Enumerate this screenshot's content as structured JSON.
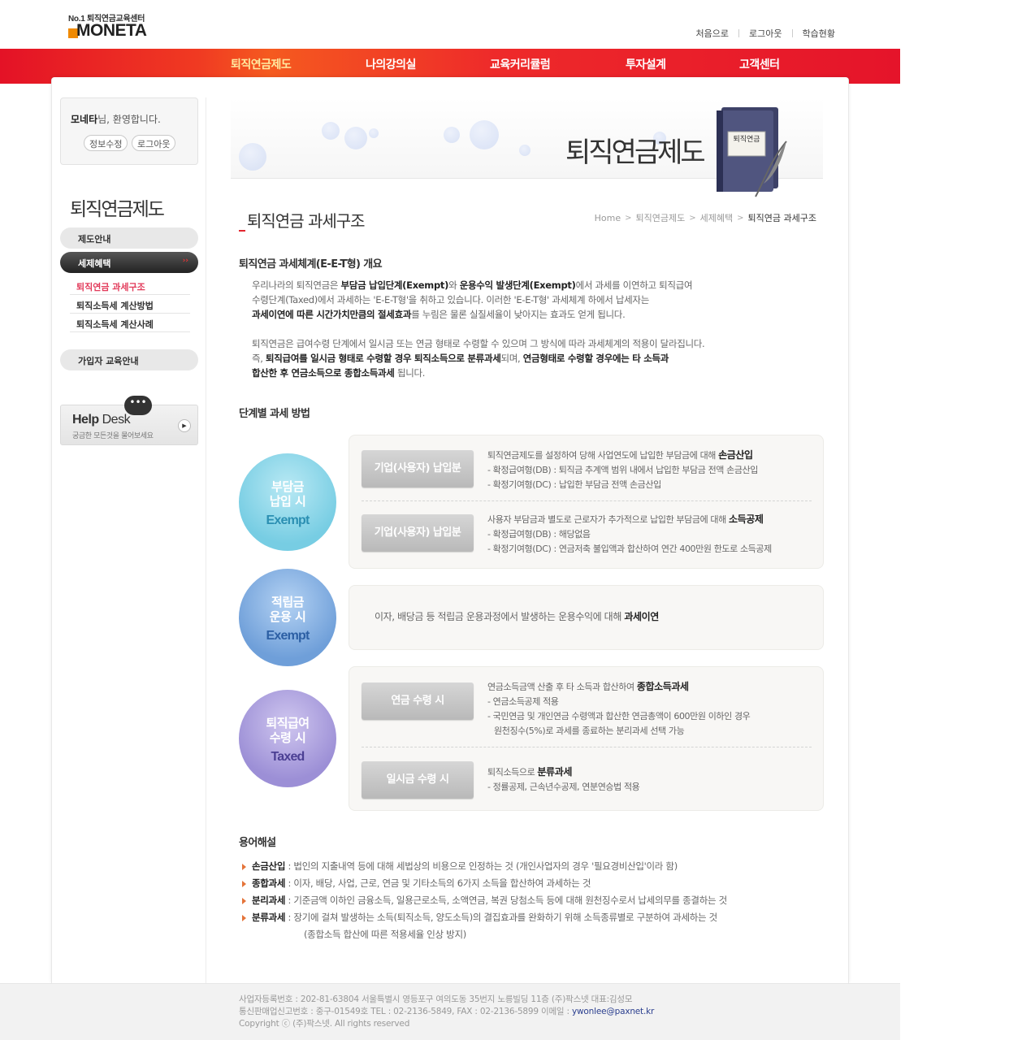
{
  "header": {
    "logo_top": "No.1 퇴직연금교육센터",
    "logo_word": "MONETA",
    "util_links": [
      "처음으로",
      "로그아웃",
      "학습현황"
    ]
  },
  "gnb": {
    "items": [
      "퇴직연금제도",
      "나의강의실",
      "교육커리큘럼",
      "투자설계",
      "고객센터"
    ],
    "active": "퇴직연금제도"
  },
  "login": {
    "user": "모네타",
    "greeting": "님, 환영합니다.",
    "edit_info": "정보수정",
    "logout": "로그아웃"
  },
  "lnb": {
    "title": "퇴직연금제도",
    "menu1": "제도안내",
    "menu2": "세제혜택",
    "sub": [
      "퇴직연금 과세구조",
      "퇴직소득세 계산방법",
      "퇴직소득세 계산사례"
    ],
    "menu3": "가입자 교육안내",
    "arrow": "››"
  },
  "help": {
    "title_bold": "Help",
    "title_rest": " Desk",
    "sub": "궁금한 모든것을 물어보세요",
    "bubble": "•••"
  },
  "visual": {
    "title": "퇴직연금제도",
    "book_label": "퇴직연금"
  },
  "page": {
    "title": "퇴직연금 과세구조",
    "breadcrumb": [
      "Home",
      "퇴직연금제도",
      "세제혜택",
      "퇴직연금 과세구조"
    ]
  },
  "section1": {
    "title": "퇴직연금 과세체계(E-E-T형) 개요",
    "p1_l1_a": "우리나라의 퇴직연금은 ",
    "p1_l1_b": "부담금 납입단계(Exempt)",
    "p1_l1_c": "와 ",
    "p1_l1_d": "운용수익 발생단계(Exempt)",
    "p1_l1_e": "에서 과세를 이연하고 퇴직급여",
    "p1_l2": "수령단계(Taxed)에서 과세하는 'E-E-T형'을 취하고 있습니다. 이러한 'E-E-T형' 과세체계 하에서 납세자는",
    "p1_l3_b": "과세이연에 따른 시간가치만큼의 절세효과",
    "p1_l3_c": "를 누림은 물론 실질세율이 낮아지는 효과도 얻게 됩니다.",
    "p2_l1": "퇴직연금은 급여수령 단계에서 일시금 또는 연금 형태로 수령할 수 있으며 그 방식에 따라 과세체계의 적용이 달라집니다.",
    "p2_l2_a": "즉, ",
    "p2_l2_b": "퇴직급여를 일시금 형태로 수령할 경우 퇴직소득으로 분류과세",
    "p2_l2_c": "되며, ",
    "p2_l2_d": "연금형태로 수령할 경우에는 타 소득과",
    "p2_l3_b": "합산한 후 연금소득으로 종합소득과세",
    "p2_l3_c": " 됩니다."
  },
  "section2": {
    "title": "단계별 과세 방법",
    "stage1": {
      "circle_l1": "부담금",
      "circle_l2": "납입 시",
      "circle_en": "Exempt",
      "row1": {
        "button": "기업(사용자) 납입분",
        "line1_a": "퇴직연금제도를 설정하여 당해 사업연도에 납입한 부담금에 대해 ",
        "line1_b": "손금산입",
        "line2": "- 확정급여형(DB) : 퇴직금 추계액 범위 내에서 납입한 부담금 전액 손금산입",
        "line3": "- 확정기여형(DC) : 납입한 부담금 전액 손금산입"
      },
      "row2": {
        "button": "기업(사용자) 납입분",
        "line1_a": "사용자 부담금과 별도로 근로자가 추가적으로 납입한 부담금에 대해 ",
        "line1_b": "소득공제",
        "line2": "- 확정급여형(DB) : 해당없음",
        "line3": "- 확정기여형(DC) : 연금저축 불입액과 합산하여 연간 400만원 한도로 소득공제"
      }
    },
    "stage2": {
      "circle_l1": "적립금",
      "circle_l2": "운용 시",
      "circle_en": "Exempt",
      "text_a": "이자, 배당금 등 적립금 운용과정에서 발생하는 운용수익에 대해 ",
      "text_b": "과세이연"
    },
    "stage3": {
      "circle_l1": "퇴직급여",
      "circle_l2": "수령 시",
      "circle_en": "Taxed",
      "row1": {
        "button": "연금 수령 시",
        "line1_a": "연금소득금액 산출 후 타 소득과 합산하여 ",
        "line1_b": "종합소득과세",
        "line2": "- 연금소득공제 적용",
        "line3": "- 국민연금 및 개인연금 수령액과 합산한 연금총액이 600만원 이하인 경우",
        "line4": "  원천징수(5%)로 과세를 종료하는 분리과세 선택 가능"
      },
      "row2": {
        "button": "일시금 수령 시",
        "line1_a": "퇴직소득으로 ",
        "line1_b": "분류과세",
        "line2": "- 정률공제, 근속년수공제, 연분연승법 적용"
      }
    }
  },
  "section3": {
    "title": "용어해설",
    "terms": [
      {
        "term": "손금산입",
        "desc": " : 법인의 지출내역 등에 대해 세법상의 비용으로 인정하는 것 (개인사업자의 경우 '필요경비산입'이라 함)"
      },
      {
        "term": "종합과세",
        "desc": " : 이자, 배당, 사업, 근로, 연금 및 기타소득의 6가지 소득을 합산하여 과세하는 것"
      },
      {
        "term": "분리과세",
        "desc": " : 기준금액 이하인 금융소득, 일용근로소득, 소액연금, 복권 당첨소득 등에 대해 원천징수로서 납세의무를 종결하는 것"
      },
      {
        "term": "분류과세",
        "desc": " : 장기에 걸쳐 발생하는 소득(퇴직소득, 양도소득)의 결집효과를 완화하기 위해 소득종류별로 구분하여 과세하는 것"
      }
    ],
    "term4_cont": "(종합소득 합산에 따른 적용세율 인상 방지)"
  },
  "footer": {
    "line1": "사업자등록번호 : 202-81-63804 서울특별시 영등포구 여의도동 35번지 노릉빌딩 11층 (주)팍스넷 대표:김성모",
    "line2_a": "통신판매업신고번호 : 중구-01549호 TEL : 02-2136-5849, FAX : 02-2136-5899 이메일 : ",
    "email": "ywonlee@paxnet.kr",
    "line3": "Copyright ⓒ (주)팍스넷. All rights reserved"
  },
  "colors": {
    "gnb_red": "#e41226",
    "accent_pink": "#e23a5a",
    "exempt1": "#77cde3",
    "exempt2": "#6f9fd9",
    "taxed": "#9c8fd6"
  }
}
